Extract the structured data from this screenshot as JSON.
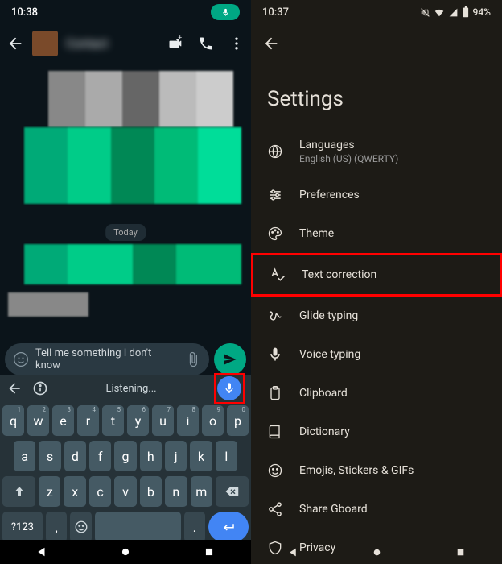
{
  "left": {
    "status_time": "10:38",
    "chat_name": "Contact",
    "date_chip": "Today",
    "input_text": "Tell me something I don't know",
    "kb_status": "Listening...",
    "keys_row1": [
      "q",
      "w",
      "e",
      "r",
      "t",
      "y",
      "u",
      "i",
      "o",
      "p"
    ],
    "keys_row1_sup": [
      "1",
      "2",
      "3",
      "4",
      "5",
      "6",
      "7",
      "8",
      "9",
      "0"
    ],
    "keys_row2": [
      "a",
      "s",
      "d",
      "f",
      "g",
      "h",
      "j",
      "k",
      "l"
    ],
    "keys_row3": [
      "z",
      "x",
      "c",
      "v",
      "b",
      "n",
      "m"
    ],
    "key_symbols": "?123",
    "key_comma": ",",
    "key_period": "."
  },
  "right": {
    "status_time": "10:37",
    "battery": "94%",
    "title": "Settings",
    "items": [
      {
        "label": "Languages",
        "sub": "English (US) (QWERTY)",
        "icon": "globe"
      },
      {
        "label": "Preferences",
        "icon": "sliders"
      },
      {
        "label": "Theme",
        "icon": "palette"
      },
      {
        "label": "Text correction",
        "icon": "spellcheck",
        "highlight": true
      },
      {
        "label": "Glide typing",
        "icon": "gesture"
      },
      {
        "label": "Voice typing",
        "icon": "mic"
      },
      {
        "label": "Clipboard",
        "icon": "clipboard"
      },
      {
        "label": "Dictionary",
        "icon": "book"
      },
      {
        "label": "Emojis, Stickers & GIFs",
        "icon": "emoji"
      },
      {
        "label": "Share Gboard",
        "icon": "share"
      },
      {
        "label": "Privacy",
        "icon": "shield"
      }
    ]
  }
}
